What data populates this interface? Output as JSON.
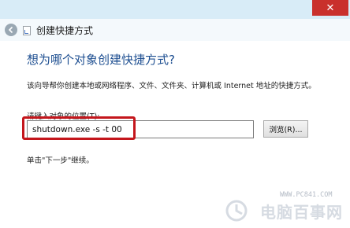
{
  "window": {
    "close_glyph": "✕",
    "accent_color": "#c9302c"
  },
  "nav": {
    "back_icon": "back-arrow-icon",
    "title": "创建快捷方式"
  },
  "main": {
    "heading": "想为哪个对象创建快捷方式?",
    "description": "该向导帮你创建本地或网络程序、文件、文件夹、计算机或 Internet 地址的快捷方式。",
    "location_label": "请键入对象的位置(T):",
    "location_value": "shutdown.exe -s -t 00",
    "browse_label": "浏览(R)...",
    "hint": "单击\"下一步\"继续。",
    "highlight_color": "#c4161c"
  },
  "watermark": {
    "url": "WWW.PC841.COM",
    "text": "电脑百事网"
  }
}
